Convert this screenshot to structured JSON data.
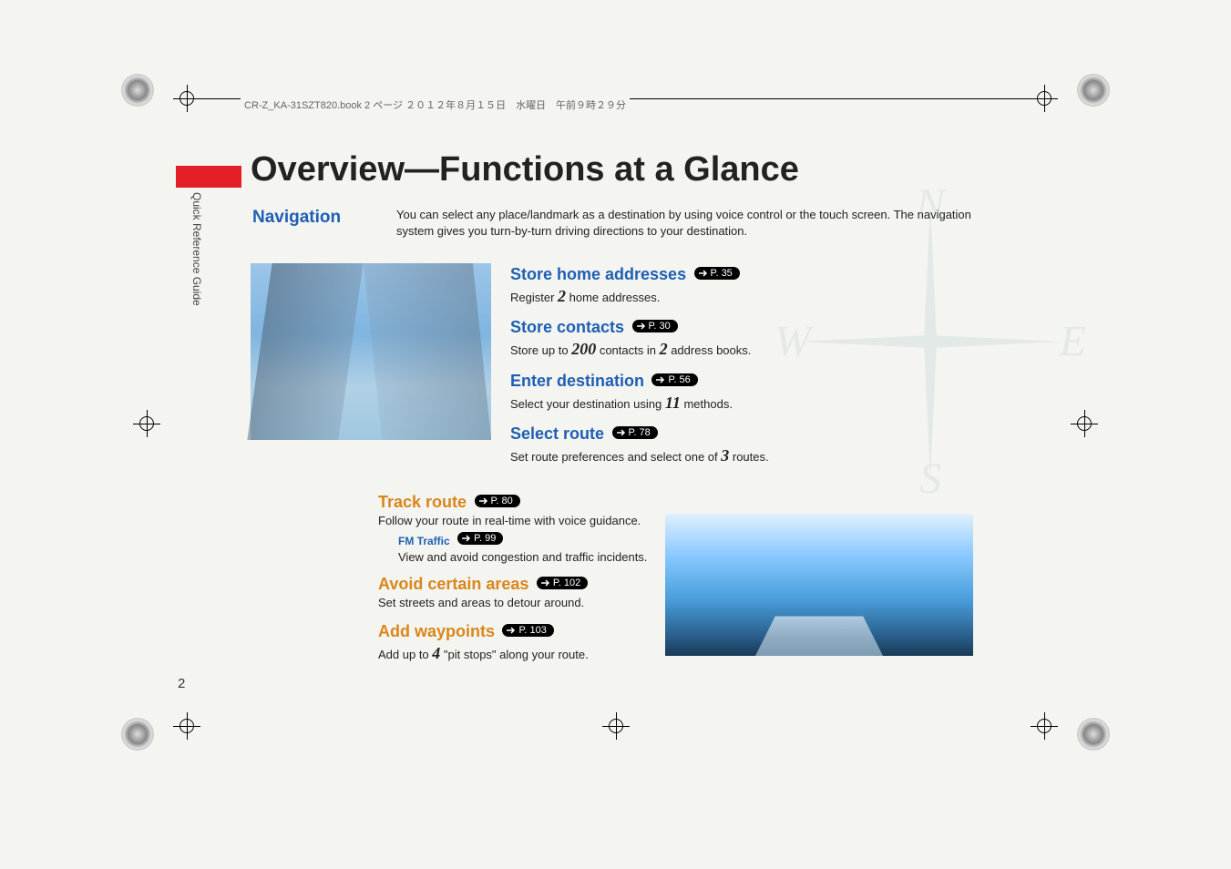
{
  "header_text": "CR-Z_KA-31SZT820.book  2 ページ  ２０１２年８月１５日　水曜日　午前９時２９分",
  "side_label": "Quick Reference Guide",
  "title": "Overview—Functions at a Glance",
  "nav_label": "Navigation",
  "intro": "You can select any place/landmark as a destination by using voice control or the touch screen. The navigation system gives you turn-by-turn driving directions to your destination.",
  "compass": {
    "n": "N",
    "s": "S",
    "e": "E",
    "w": "W"
  },
  "features_top": [
    {
      "title": "Store home addresses",
      "page": "P. 35",
      "desc_pre": "Register ",
      "num": "2",
      "desc_post": " home addresses."
    },
    {
      "title": "Store contacts",
      "page": "P. 30",
      "desc_pre": "Store up to ",
      "num": "200",
      "desc_mid": " contacts in ",
      "num2": "2",
      "desc_post": " address books."
    },
    {
      "title": "Enter destination",
      "page": "P. 56",
      "desc_pre": "Select your destination using ",
      "num": "11",
      "desc_post": " methods."
    },
    {
      "title": "Select route",
      "page": "P. 78",
      "desc_pre": "Set route preferences and select one of ",
      "num": "3",
      "desc_post": " routes."
    }
  ],
  "features_bot": [
    {
      "title": "Track route",
      "style": "orange",
      "page": "P. 80",
      "desc": "Follow your route in real-time with voice guidance.",
      "sub": {
        "title": "FM Traffic",
        "page": "P. 99",
        "desc": "View and avoid congestion and traffic incidents."
      }
    },
    {
      "title": "Avoid certain areas",
      "style": "orange",
      "page": "P. 102",
      "desc": "Set streets and areas to detour around."
    },
    {
      "title": "Add waypoints",
      "style": "orange",
      "page": "P. 103",
      "desc_pre": "Add up to ",
      "num": "4",
      "desc_post": " \"pit stops\" along your route."
    }
  ],
  "page_num": "2"
}
